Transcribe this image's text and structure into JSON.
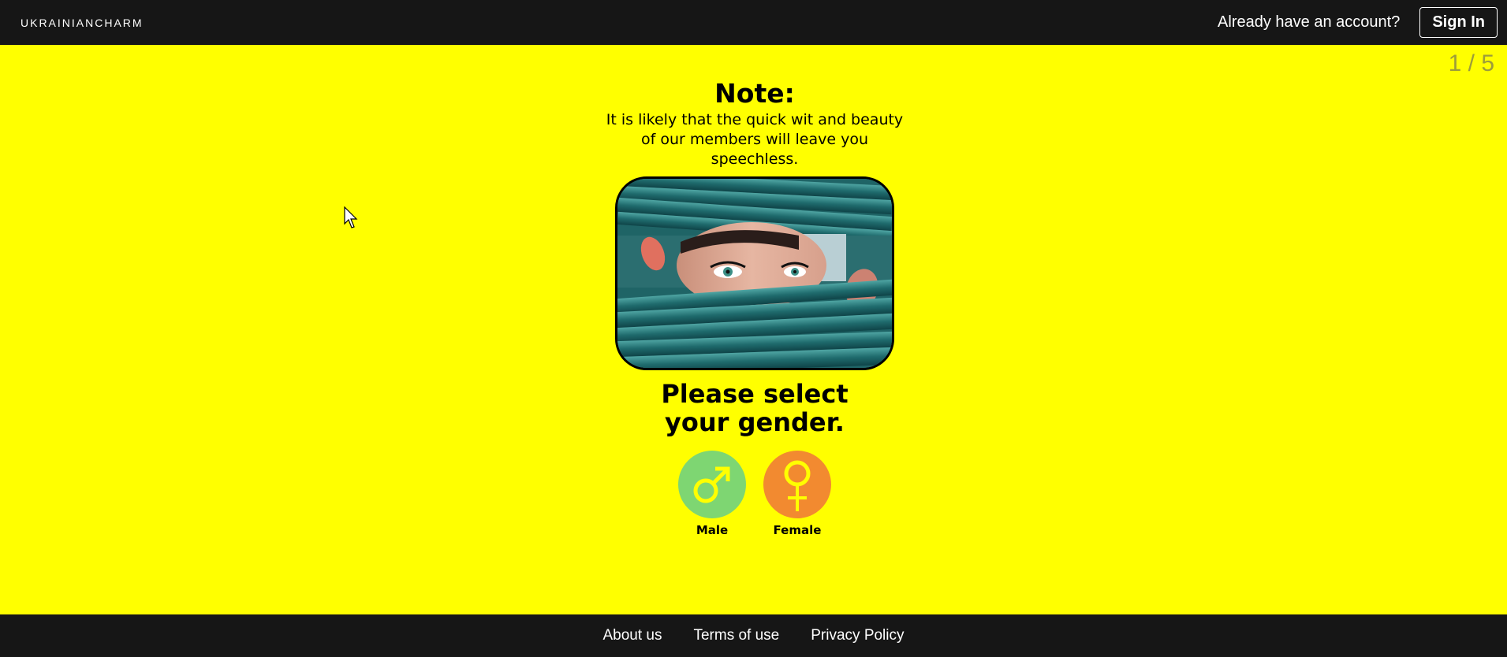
{
  "header": {
    "logo": "UKRAINIANCHARM",
    "account_prompt": "Already have an account?",
    "signin_label": "Sign In"
  },
  "step_counter": "1 / 5",
  "note": {
    "title": "Note:",
    "text": "It is likely that the quick wit and beauty of our members will leave you speechless."
  },
  "prompt": "Please select your gender.",
  "genders": [
    {
      "label": "Male",
      "icon": "male-symbol-icon",
      "color": "#7ed672"
    },
    {
      "label": "Female",
      "icon": "female-symbol-icon",
      "color": "#f28a30"
    }
  ],
  "footer": {
    "links": [
      "About us",
      "Terms of use",
      "Privacy Policy"
    ]
  },
  "colors": {
    "background": "#ffff00",
    "bar": "#161616",
    "symbol": "#ffff00"
  }
}
